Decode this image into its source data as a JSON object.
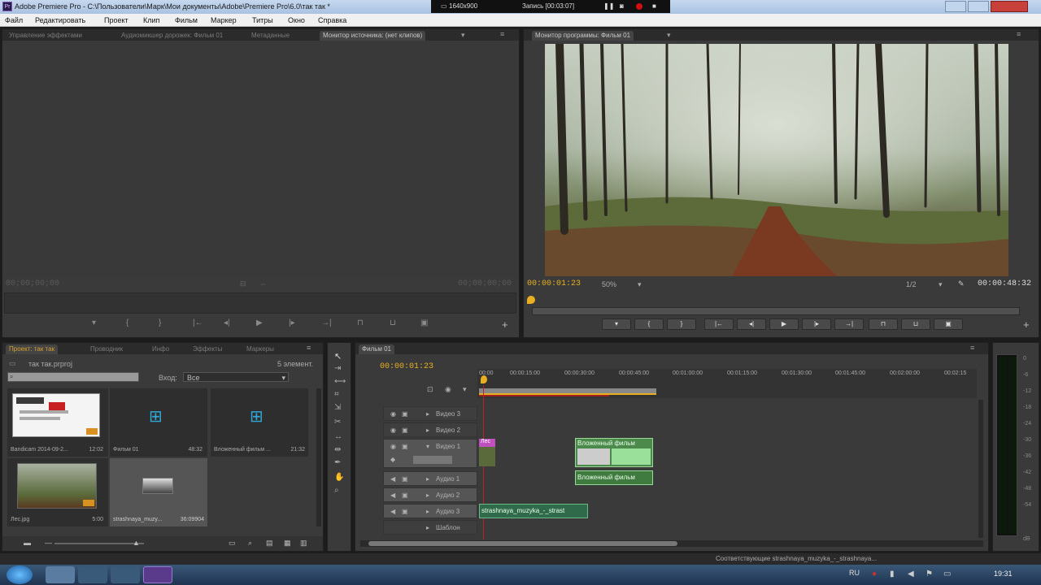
{
  "titlebar": {
    "title": "Adobe Premiere Pro - C:\\Пользователи\\Марк\\Мои документы\\Adobe\\Premiere Pro\\6.0\\так так *"
  },
  "recorder": {
    "resolution": "1640x900",
    "record_label": "Запись [00:03:07]"
  },
  "menu": [
    "Файл",
    "Редактировать",
    "Проект",
    "Клип",
    "Фильм",
    "Маркер",
    "Титры",
    "Окно",
    "Справка"
  ],
  "source_panel": {
    "tabs": [
      "Управление эффектами",
      "Аудиомикшер дорожек: Фильм 01",
      "Метаданные",
      "Монитор источника: (нет клипов)"
    ],
    "timecode_left": "00;00;00;00",
    "timecode_right": "00;00;00;00"
  },
  "program_panel": {
    "tab": "Монитор программы: Фильм 01",
    "timecode_current": "00:00:01:23",
    "zoom": "50%",
    "resolution": "1/2",
    "timecode_duration": "00:00:48:32"
  },
  "project_panel": {
    "tabs": [
      "Проект: так так",
      "Проводник",
      "Инфо",
      "Эффекты",
      "Маркеры"
    ],
    "project_file": "так так.prproj",
    "item_count": "5 элемент.",
    "view_label": "Вход:",
    "view_value": "Все",
    "items": [
      {
        "name": "Bandicam 2014-09-2...",
        "duration": "12:02"
      },
      {
        "name": "Фильм 01",
        "duration": "48:32"
      },
      {
        "name": "Вложенный фильм ...",
        "duration": "21:32"
      },
      {
        "name": "Лес.jpg",
        "duration": "5:00"
      },
      {
        "name": "strashnaya_muzy...",
        "duration": "36:09904"
      }
    ]
  },
  "timeline": {
    "tab": "Фильм 01",
    "timecode": "00:00:01:23",
    "ruler": [
      "00:00",
      "00:00:15:00",
      "00:00:30:00",
      "00:00:45:00",
      "00:01:00:00",
      "00:01:15:00",
      "00:01:30:00",
      "00:01:45:00",
      "00:02:00:00",
      "00:02:15"
    ],
    "tracks": [
      "Видео 3",
      "Видео 2",
      "Видео 1",
      "Аудио 1",
      "Аудио 2",
      "Аудио 3",
      "Шаблон"
    ],
    "clips": {
      "les": "Лес",
      "nested_video": "Вложенный фильм",
      "nested_audio": "Вложенный фильм",
      "music": "strashnaya_muzyka_-_strast"
    }
  },
  "audio_meter": [
    "0",
    "-6",
    "-12",
    "-18",
    "-24",
    "-30",
    "-36",
    "-42",
    "-48",
    "-54",
    "dB"
  ],
  "statusbar": {
    "text": "Соответствующие strashnaya_muzyka_-_strashnaya..."
  },
  "taskbar": {
    "lang": "RU",
    "time": "19:31"
  }
}
